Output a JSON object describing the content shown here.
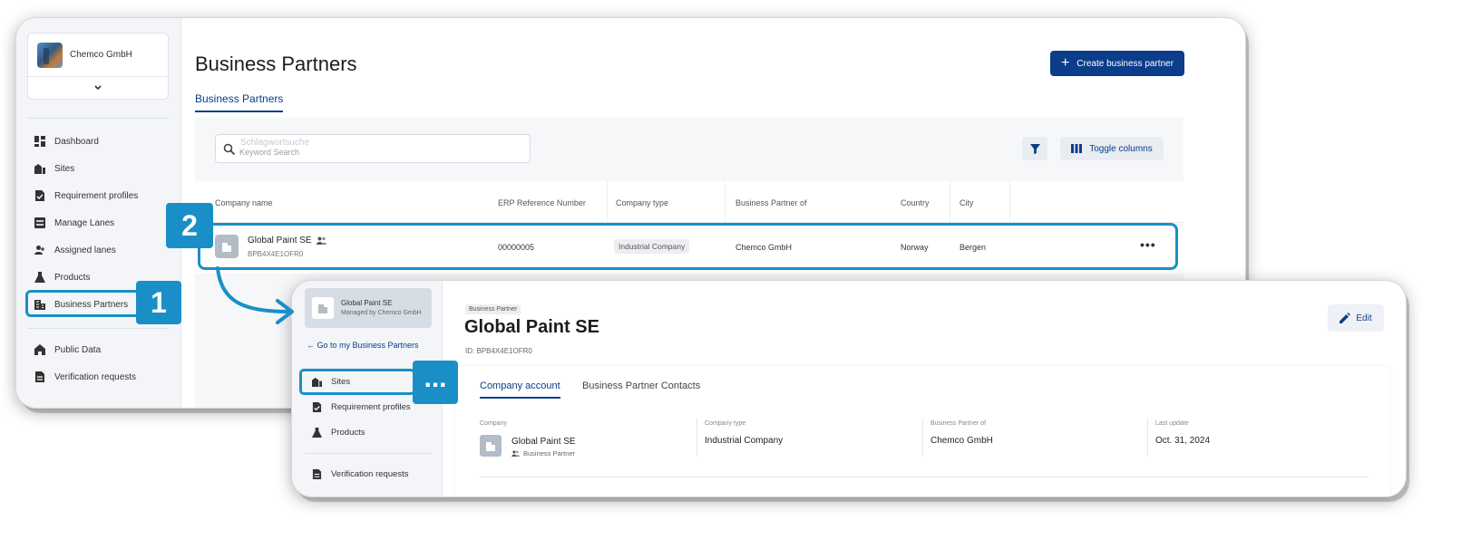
{
  "window1": {
    "org": {
      "name": "Chemco GmbH"
    },
    "sidebar": {
      "items": [
        {
          "label": "Dashboard",
          "icon": "dashboard-icon"
        },
        {
          "label": "Sites",
          "icon": "sites-icon"
        },
        {
          "label": "Requirement profiles",
          "icon": "requirement-icon"
        },
        {
          "label": "Manage Lanes",
          "icon": "lanes-icon"
        },
        {
          "label": "Assigned lanes",
          "icon": "assigned-icon"
        },
        {
          "label": "Products",
          "icon": "flask-icon"
        },
        {
          "label": "Business Partners",
          "icon": "building-icon"
        },
        {
          "label": "Public Data",
          "icon": "public-data-icon"
        },
        {
          "label": "Verification requests",
          "icon": "verification-icon"
        }
      ]
    },
    "page_title": "Business Partners",
    "create_button": "Create business partner",
    "tab": "Business Partners",
    "search": {
      "label": "Schlagwortsuche",
      "placeholder": "Keyword Search"
    },
    "toggle_columns": "Toggle columns",
    "table": {
      "columns": [
        "Company name",
        "ERP Reference Number",
        "Company type",
        "Business Partner of",
        "Country",
        "City"
      ],
      "rows": [
        {
          "name": "Global Paint SE",
          "id": "BPB4X4E1OFR0",
          "erp": "00000005",
          "type": "Industrial Company",
          "partner_of": "Chemco GmbH",
          "country": "Norway",
          "city": "Bergen"
        }
      ]
    }
  },
  "window2": {
    "card": {
      "name": "Global Paint SE",
      "sub": "Managed by Chemco GmbH"
    },
    "back_link": "Go to my Business Partners",
    "sidebar": {
      "items": [
        {
          "label": "Sites",
          "icon": "sites-icon"
        },
        {
          "label": "Requirement profiles",
          "icon": "requirement-icon"
        },
        {
          "label": "Products",
          "icon": "flask-icon"
        },
        {
          "label": "Verification requests",
          "icon": "verification-icon"
        }
      ]
    },
    "tag": "Business Partner",
    "title": "Global Paint SE",
    "id_line": "ID: BPB4X4E1OFR0",
    "edit_button": "Edit",
    "tabs": [
      "Company account",
      "Business Partner Contacts"
    ],
    "info": {
      "company_label": "Company",
      "company_name": "Global Paint SE",
      "company_sub": "Business Partner",
      "type_label": "Company type",
      "type_value": "Industrial Company",
      "partner_label": "Business Partner of",
      "partner_value": "Chemco GmbH",
      "update_label": "Last update",
      "update_value": "Oct. 31, 2024"
    }
  },
  "callouts": {
    "one": "1",
    "two": "2",
    "dots": "..."
  },
  "colors": {
    "accent": "#1a8fc7",
    "primary": "#0b3d8a"
  }
}
